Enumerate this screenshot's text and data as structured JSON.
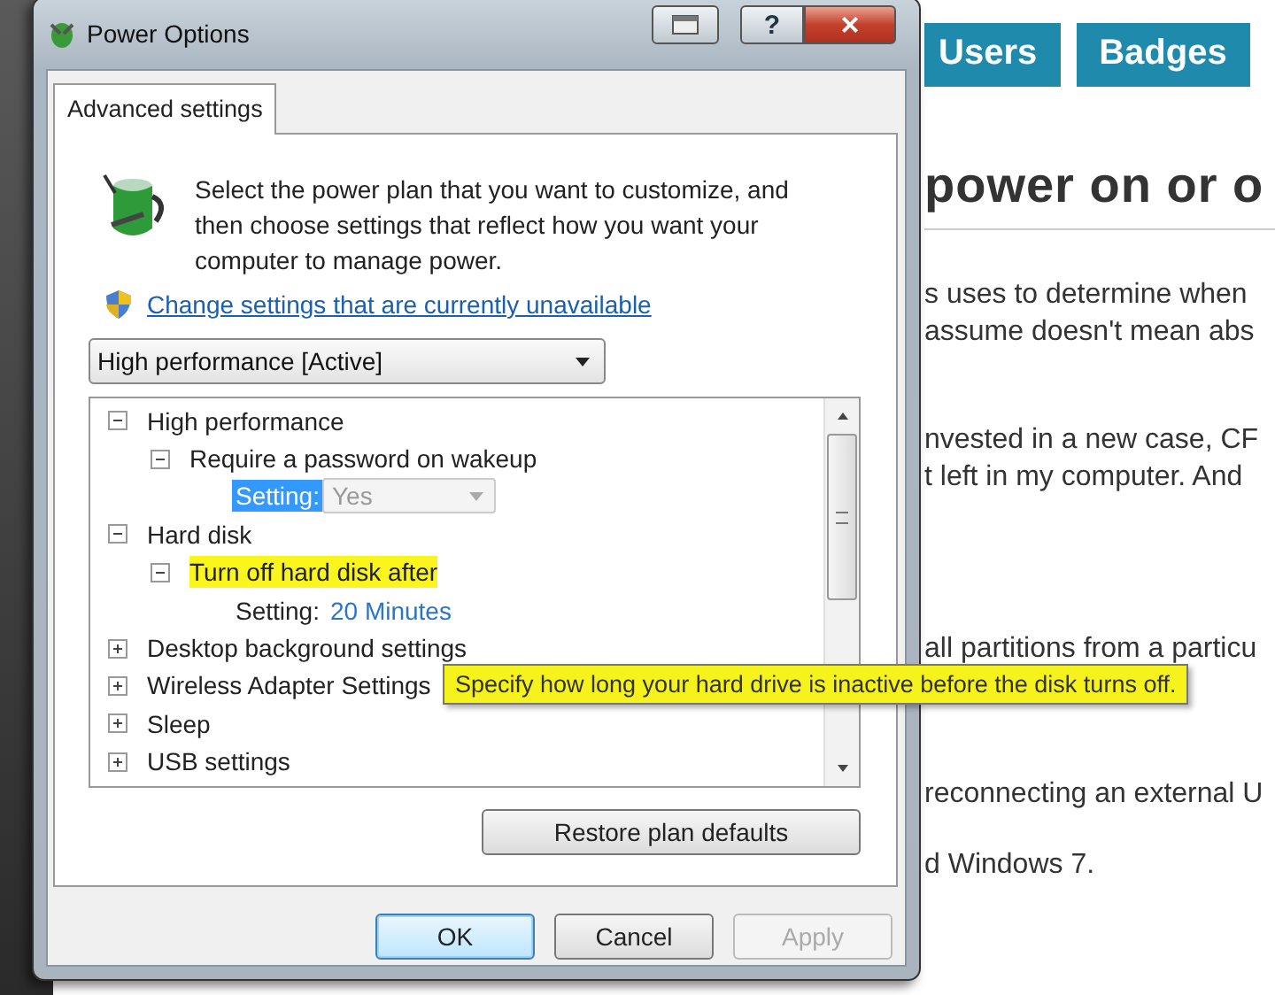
{
  "background_page": {
    "nav": [
      "Users",
      "Badges"
    ],
    "heading": "power on or o",
    "paragraphs": [
      [
        "s uses to determine when",
        "assume doesn't mean abs"
      ],
      [
        "nvested in a new case, CF",
        "t left in my computer. And"
      ],
      [
        "all partitions from a particu"
      ],
      [
        "reconnecting an external U"
      ],
      [
        "d Windows 7."
      ]
    ]
  },
  "window": {
    "title": "Power Options"
  },
  "title_buttons": [
    {
      "kind": "switch"
    },
    {
      "kind": "help",
      "label": "?"
    },
    {
      "kind": "close",
      "label": "×"
    }
  ],
  "tabs": [
    {
      "label": "Advanced settings",
      "selected": true
    }
  ],
  "intro": "Select the power plan that you want to customize, and then choose settings that reflect how you want your computer to manage power.",
  "link": "Change settings that are currently unavailable",
  "plan_dropdown": {
    "value": "High performance [Active]"
  },
  "tree": [
    {
      "kind": "group",
      "label": "High performance",
      "expanded": true,
      "highlighted": false,
      "children": [
        {
          "kind": "group",
          "label": "Require a password on wakeup",
          "expanded": true,
          "highlighted": false,
          "children": [
            {
              "kind": "setting_combo",
              "label": "Setting:",
              "selected": true,
              "value": "Yes",
              "disabled": true
            }
          ]
        }
      ]
    },
    {
      "kind": "group",
      "label": "Hard disk",
      "expanded": true,
      "highlighted": false,
      "children": [
        {
          "kind": "group",
          "label": "Turn off hard disk after",
          "expanded": true,
          "highlighted": true,
          "children": [
            {
              "kind": "setting_link",
              "label": "Setting:",
              "selected": false,
              "value": "20 Minutes"
            }
          ]
        }
      ]
    },
    {
      "kind": "group",
      "label": "Desktop background settings",
      "expanded": false,
      "highlighted": false
    },
    {
      "kind": "group",
      "label": "Wireless Adapter Settings",
      "expanded": false,
      "highlighted": false
    },
    {
      "kind": "group",
      "label": "Sleep",
      "expanded": false,
      "highlighted": false
    },
    {
      "kind": "group",
      "label": "USB settings",
      "expanded": false,
      "highlighted": false
    }
  ],
  "restore_button": "Restore plan defaults",
  "buttons": [
    {
      "label": "OK",
      "default": true,
      "disabled": false
    },
    {
      "label": "Cancel",
      "default": false,
      "disabled": false
    },
    {
      "label": "Apply",
      "default": false,
      "disabled": true
    }
  ],
  "tooltip": "Specify how long your hard drive is inactive before the disk turns off."
}
